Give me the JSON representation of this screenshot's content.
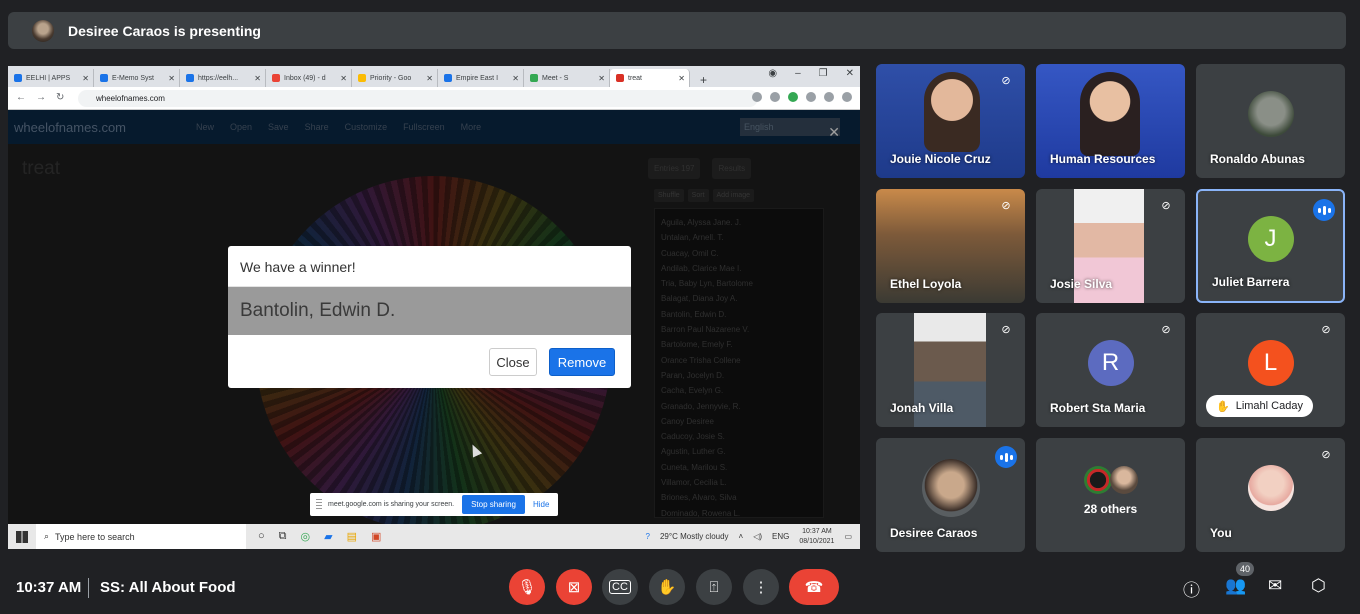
{
  "header": {
    "presenter_text": "Desiree Caraos is presenting"
  },
  "browser": {
    "tabs": [
      {
        "label": "EELHI | APPS"
      },
      {
        "label": "E-Memo Syst"
      },
      {
        "label": "https://eelh..."
      },
      {
        "label": "Inbox (49) - d"
      },
      {
        "label": "Priority - Goo"
      },
      {
        "label": "Empire East I"
      },
      {
        "label": "Meet - S"
      },
      {
        "label": "treat"
      }
    ],
    "url": "wheelofnames.com"
  },
  "site": {
    "logo": "wheelofnames.com",
    "menu": [
      "New",
      "Open",
      "Save",
      "Share",
      "Customize",
      "Fullscreen",
      "More"
    ],
    "language": "English",
    "title": "treat",
    "panel_tabs": [
      "Entries 197",
      "Results"
    ],
    "panel_buttons": [
      "Shuffle",
      "Sort",
      "Add image"
    ],
    "names": [
      "Aguila, Alyssa Jane. J.",
      "Untalan, Arnell. T.",
      "Cuacay, Omil C.",
      "Andilab, Clarice Mae I.",
      "Tria, Baby Lyn, Bartolome",
      "Balagat, Diana Joy A.",
      "Bantolin, Edwin D.",
      "Barron Paul Nazarene V.",
      "Bartolome, Emely F.",
      "Orance Trisha Collene",
      "Paran, Jocelyn D.",
      "Cacha, Evelyn G.",
      "Granado, Jennyvie, R.",
      "Canoy Desiree",
      "Caducoy, Josie S.",
      "Agustin, Luther G.",
      "Cuneta, Marilou S.",
      "Villamor, Cecilia L.",
      "Briones, Alvaro, Silva",
      "Dominado, Rowena L.",
      "De Guzman, Jonathan H."
    ]
  },
  "dialog": {
    "title": "We have a winner!",
    "winner": "Bantolin, Edwin D.",
    "close_label": "Close",
    "remove_label": "Remove"
  },
  "sharebar": {
    "message": "meet.google.com is sharing your screen.",
    "stop_label": "Stop sharing",
    "hide_label": "Hide"
  },
  "taskbar": {
    "search_placeholder": "Type here to search",
    "weather": "29°C  Mostly cloudy",
    "lang": "ENG",
    "time": "10:37 AM",
    "date": "08/10/2021"
  },
  "participants": [
    {
      "name": "Jouie Nicole Cruz"
    },
    {
      "name": "Human Resources"
    },
    {
      "name": "Ronaldo Abunas"
    },
    {
      "name": "Ethel Loyola"
    },
    {
      "name": "Josie Silva"
    },
    {
      "name": "Juliet Barrera",
      "initial": "J",
      "color": "#7cb342"
    },
    {
      "name": "Jonah Villa"
    },
    {
      "name": "Robert Sta Maria",
      "initial": "R",
      "color": "#5c6bc0"
    },
    {
      "name": "Limahl Caday",
      "initial": "L",
      "color": "#f4511e"
    },
    {
      "name": "Desiree Caraos"
    },
    {
      "name": "28 others"
    },
    {
      "name": "You"
    }
  ],
  "bottom": {
    "time": "10:37 AM",
    "meeting": "SS: All About Food",
    "participant_count": "40"
  },
  "colors": {
    "accent": "#1a73e8",
    "danger": "#ea4335",
    "tile": "#3c4043",
    "bg": "#202124"
  }
}
